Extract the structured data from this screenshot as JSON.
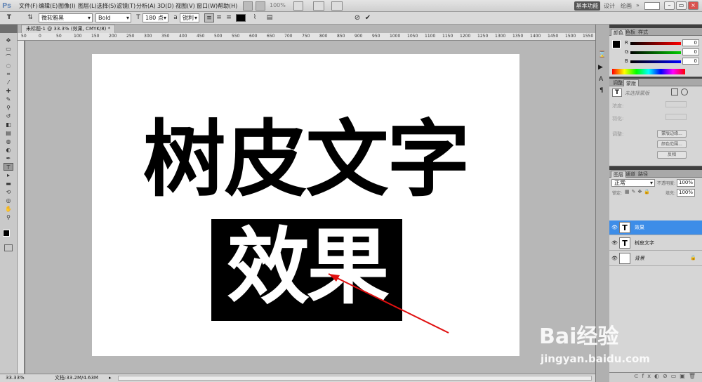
{
  "app": {
    "logo": "Ps"
  },
  "menu": [
    "文件(F)",
    "编辑(E)",
    "图像(I)",
    "图层(L)",
    "选择(S)",
    "滤镜(T)",
    "分析(A)",
    "3D(D)",
    "视图(V)",
    "窗口(W)",
    "帮助(H)"
  ],
  "zoom_menu": "100%",
  "workspace": {
    "active": "基本功能",
    "links": [
      "设计",
      "绘画"
    ]
  },
  "options": {
    "font_family": "微软雅黑",
    "font_style": "Bold",
    "font_size": "180 点",
    "antialias": "锐利"
  },
  "document_tab": "未标题-1 @ 33.3% (效果, CMYK/8) *",
  "ruler_labels": [
    "50",
    "0",
    "50",
    "100",
    "150",
    "200",
    "250",
    "300",
    "350",
    "400",
    "450",
    "500",
    "550",
    "600",
    "650",
    "700",
    "750",
    "800",
    "850",
    "900",
    "950",
    "1000",
    "1050",
    "1100",
    "1150",
    "1200",
    "1250",
    "1300",
    "1350",
    "1400",
    "1450",
    "1500",
    "1550"
  ],
  "canvas": {
    "line1": "树皮文字",
    "line2": "效果"
  },
  "status": {
    "zoom": "33.33%",
    "doc": "文档:33.2M/4.63M"
  },
  "color_panel": {
    "tabs": [
      "颜色",
      "色板",
      "样式"
    ],
    "channels": [
      {
        "label": "R",
        "value": "0"
      },
      {
        "label": "G",
        "value": "0"
      },
      {
        "label": "B",
        "value": "0"
      }
    ]
  },
  "mask_panel": {
    "tabs": [
      "调整",
      "蒙版"
    ],
    "title": "未选择蒙版",
    "fields": [
      "浓度:",
      "羽化:"
    ],
    "refine": "调整:",
    "buttons": [
      "蒙版边缘...",
      "颜色范围...",
      "反相"
    ]
  },
  "layers_panel": {
    "tabs": [
      "图层",
      "通道",
      "路径"
    ],
    "blend_mode": "正常",
    "opacity_label": "不透明度:",
    "opacity": "100%",
    "lock_label": "锁定:",
    "fill_label": "填充:",
    "fill": "100%",
    "layers": [
      {
        "name": "效果",
        "thumb": "T",
        "selected": true
      },
      {
        "name": "树皮文字",
        "thumb": "T",
        "selected": false
      },
      {
        "name": "背景",
        "thumb": "",
        "selected": false
      }
    ]
  },
  "watermark": {
    "brand": "Bai经验",
    "url": "jingyan.baidu.com"
  },
  "colors": {
    "selected_layer": "#3d8de8",
    "arrow": "#e01010"
  }
}
